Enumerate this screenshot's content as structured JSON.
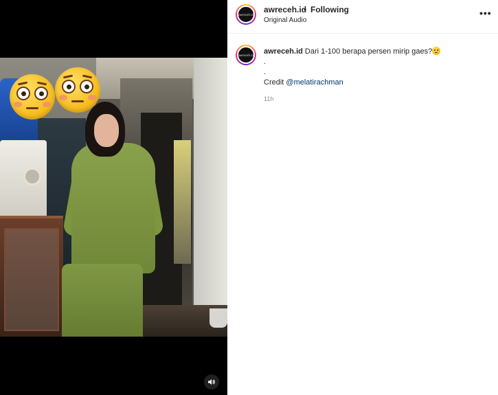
{
  "post": {
    "username": "awreceh.id",
    "separator": "•",
    "follow_status": "Following",
    "audio": "Original Audio",
    "more_icon": "•••",
    "avatar_text": "awreceh.id"
  },
  "caption": {
    "username": "awreceh.id",
    "text": "Dari 1-100 berapa persen mirip gaes?",
    "emoji": "flushed-face-emoji",
    "line2": ".",
    "line3": ".",
    "credit_label": "Credit",
    "mention": "@melatirachman",
    "timestamp": "11h"
  },
  "media": {
    "type": "video",
    "overlay_emojis": [
      "flushed-face-emoji",
      "flushed-face-emoji"
    ],
    "sound_icon": "speaker-icon"
  },
  "colors": {
    "accent_link": "#00376b",
    "text": "#262626",
    "muted": "#8e8e8e",
    "media_bg": "#000000"
  }
}
